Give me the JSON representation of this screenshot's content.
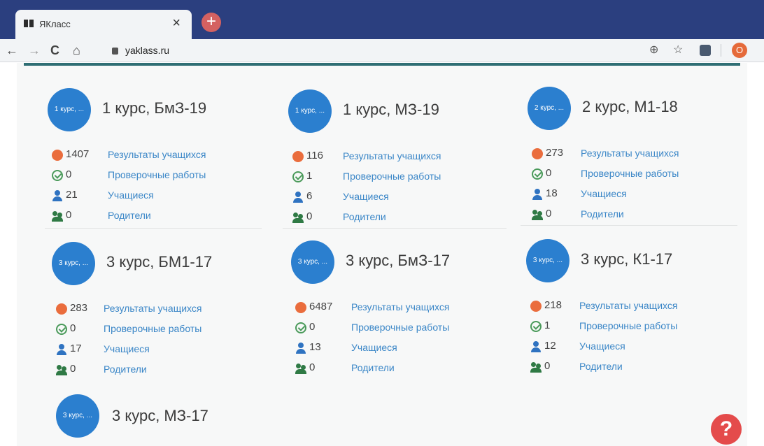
{
  "browser": {
    "tab_title": "ЯКласс",
    "close_glyph": "×",
    "new_tab_glyph": "+",
    "url": "yaklass.ru",
    "profile_initial": "O",
    "nav": {
      "back": "←",
      "forward": "→",
      "reload": "C",
      "home": "⌂"
    },
    "right_icons": {
      "add": "⊕",
      "bookmark": "☆"
    }
  },
  "labels": {
    "results": "Результаты учащихся",
    "tests": "Проверочные работы",
    "students": "Учащиеся",
    "parents": "Родители"
  },
  "courses": [
    {
      "avatar": "1 курс, ...",
      "name": "1 курс, БмЗ-19",
      "results": "1407",
      "tests": "0",
      "students": "21",
      "parents": "0"
    },
    {
      "avatar": "1 курс, ...",
      "name": "1 курс, МЗ-19",
      "results": "116",
      "tests": "1",
      "students": "6",
      "parents": "0"
    },
    {
      "avatar": "2 курс, ...",
      "name": "2 курс, М1-18",
      "results": "273",
      "tests": "0",
      "students": "18",
      "parents": "0"
    },
    {
      "avatar": "3 курс, ...",
      "name": "3 курс, БМ1-17",
      "results": "283",
      "tests": "0",
      "students": "17",
      "parents": "0"
    },
    {
      "avatar": "3 курс, ...",
      "name": "3 курс, БмЗ-17",
      "results": "6487",
      "tests": "0",
      "students": "13",
      "parents": "0"
    },
    {
      "avatar": "3 курс, ...",
      "name": "3 курс, К1-17",
      "results": "218",
      "tests": "1",
      "students": "12",
      "parents": "0"
    },
    {
      "avatar": "3 курс, ...",
      "name": "3 курс, МЗ-17"
    }
  ],
  "help_glyph": "?"
}
